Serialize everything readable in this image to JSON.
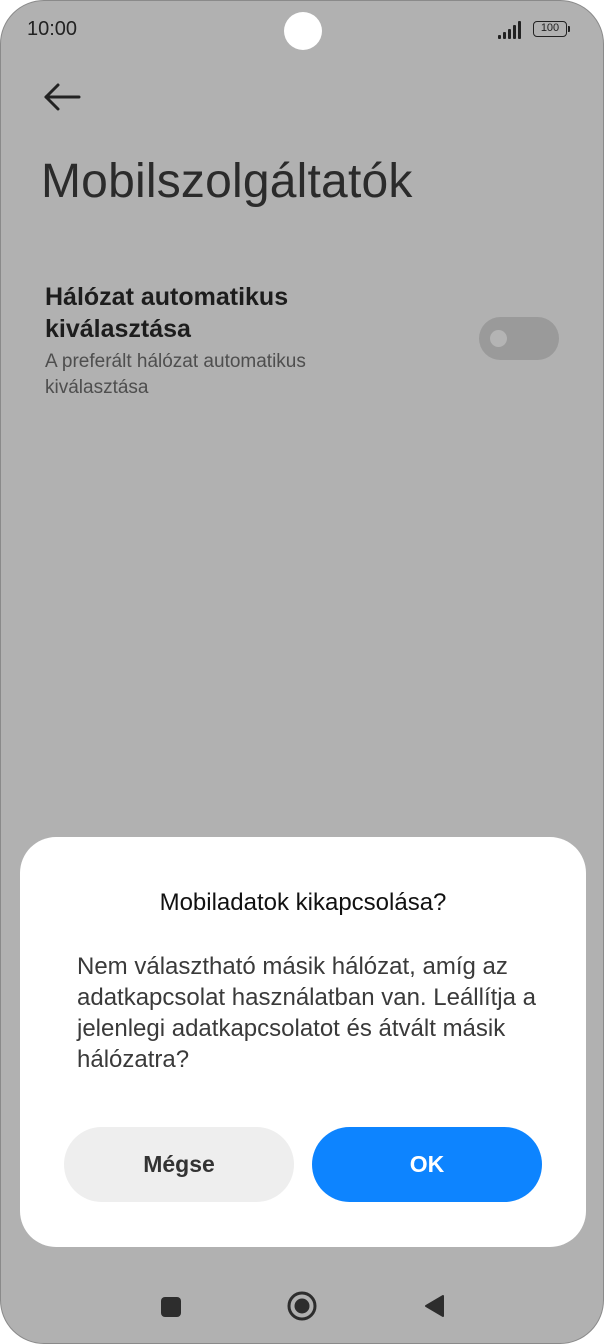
{
  "status_bar": {
    "time": "10:00",
    "battery": "100"
  },
  "header": {
    "title": "Mobilszolgáltatók"
  },
  "setting": {
    "title": "Hálózat automatikus kiválasztása",
    "subtitle": "A preferált hálózat automatikus kiválasztása",
    "toggle_on": false
  },
  "dialog": {
    "title": "Mobiladatok kikapcsolása?",
    "message": "Nem választható másik hálózat, amíg az adatkapcsolat használatban van. Leállítja a jelenlegi adatkapcsolatot és átvált másik hálózatra?",
    "cancel_label": "Mégse",
    "ok_label": "OK"
  },
  "colors": {
    "accent": "#0d84ff",
    "scrim": "#b1b1b1"
  },
  "icons": {
    "back": "arrow-left-icon",
    "recent": "square-icon",
    "home": "circle-icon",
    "nav_back": "triangle-left-icon"
  }
}
